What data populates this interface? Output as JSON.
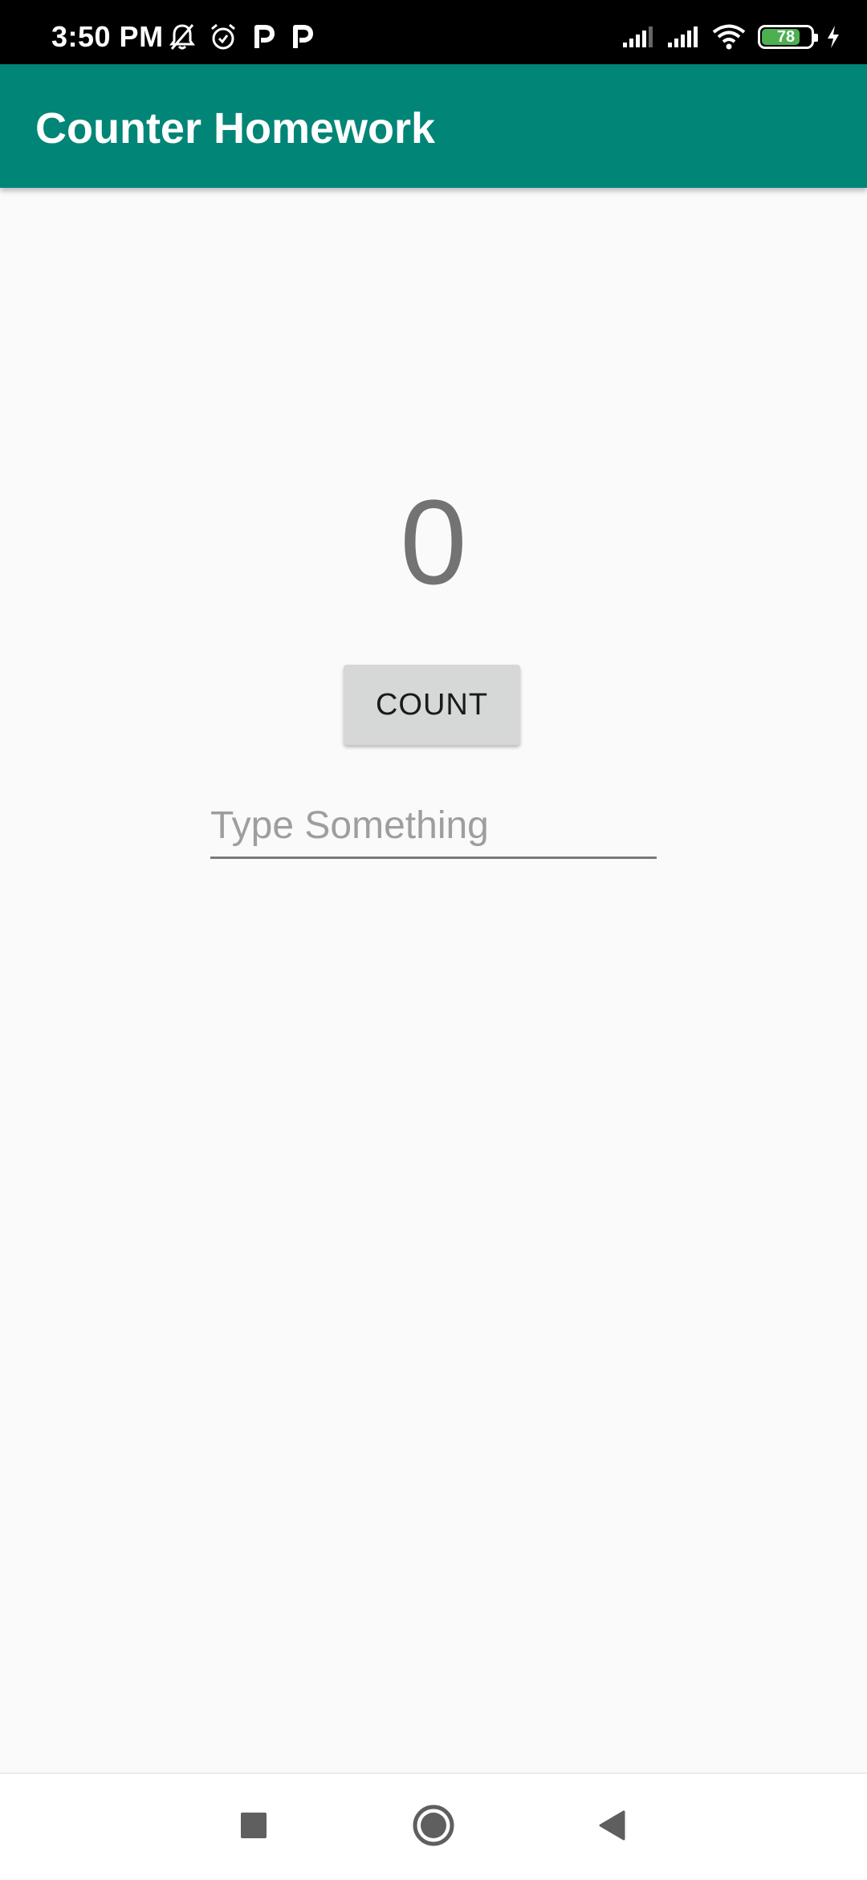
{
  "status_bar": {
    "time": "3:50 PM",
    "battery_level": "78",
    "battery_fraction": 0.78,
    "icons": [
      "mute-bell-icon",
      "alarm-icon",
      "p-app-icon",
      "p-app-icon",
      "signal-icon",
      "signal-icon",
      "wifi-icon",
      "battery-icon",
      "charging-icon"
    ]
  },
  "app_bar": {
    "title": "Counter Homework",
    "color": "#018577"
  },
  "main": {
    "counter_value": "0",
    "count_button_label": "COUNT",
    "input_placeholder": "Type Something",
    "input_value": ""
  },
  "nav_bar": {
    "icons": [
      "recents-square-icon",
      "home-circle-icon",
      "back-triangle-icon"
    ]
  }
}
